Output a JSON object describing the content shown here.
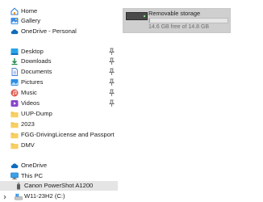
{
  "nav": {
    "home": "Home",
    "gallery": "Gallery",
    "onedrive_personal": "OneDrive - Personal",
    "desktop": "Desktop",
    "downloads": "Downloads",
    "documents": "Documents",
    "pictures": "Pictures",
    "music": "Music",
    "videos": "Videos",
    "uup_dump": "UUP-Dump",
    "year_2023": "2023",
    "fgg": "FGG-DrivingLicense and Passport",
    "dmv": "DMV",
    "onedrive": "OneDrive",
    "this_pc": "This PC",
    "canon": "Canon PowerShot A1200",
    "w11": "W11-23H2 (C:)"
  },
  "drive": {
    "title": "Removable storage",
    "free_text": "14.6 GB free of 14.8 GB",
    "used_fraction": 0.0135
  },
  "colors": {
    "folder": "#f2c14e",
    "selection": "#e5e5e5",
    "onedrive_blue": "#0f6cbd"
  }
}
